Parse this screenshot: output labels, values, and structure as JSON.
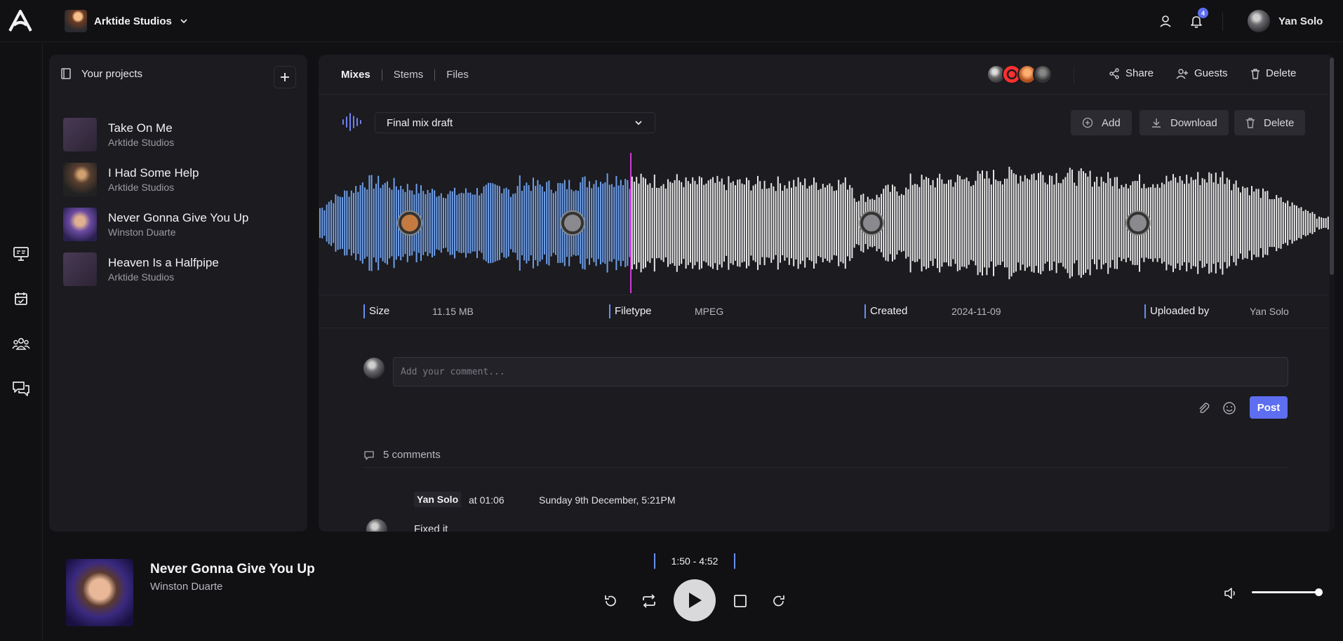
{
  "header": {
    "studio_name": "Arktide Studios",
    "notification_count": "4",
    "user_name": "Yan Solo"
  },
  "projects": {
    "title": "Your projects",
    "items": [
      {
        "title": "Take On Me",
        "owner": "Arktide Studios"
      },
      {
        "title": "I Had Some Help",
        "owner": "Arktide Studios"
      },
      {
        "title": "Never Gonna Give You Up",
        "owner": "Winston Duarte"
      },
      {
        "title": "Heaven Is a Halfpipe",
        "owner": "Arktide Studios"
      }
    ]
  },
  "main": {
    "tabs": [
      {
        "label": "Mixes"
      },
      {
        "label": "Stems"
      },
      {
        "label": "Files"
      }
    ],
    "actions": {
      "share": "Share",
      "guests": "Guests",
      "delete": "Delete"
    },
    "mix_selected": "Final mix draft",
    "tools": {
      "add": "Add",
      "download": "Download",
      "delete": "Delete"
    },
    "waveform": {
      "playhead_fraction": 0.307,
      "played_color": "#6f9ee8",
      "unplayed_color": "#e6e6e6",
      "playhead_color": "#d23ad6"
    },
    "meta": {
      "size_label": "Size",
      "size_value": "11.15 MB",
      "filetype_label": "Filetype",
      "filetype_value": "MPEG",
      "created_label": "Created",
      "created_value": "2024-11-09",
      "uploaded_label": "Uploaded by",
      "uploaded_value": "Yan Solo"
    },
    "comment_placeholder": "Add your comment...",
    "post_label": "Post",
    "comments_count": "5 comments",
    "comment": {
      "author": "Yan Solo",
      "at": "at 01:06",
      "date": "Sunday 9th December, 5:21PM",
      "text": "Fixed it"
    }
  },
  "player": {
    "title": "Never Gonna Give You Up",
    "artist": "Winston Duarte",
    "time": "1:50 - 4:52",
    "volume": 0.95
  },
  "colors": {
    "accent": "#5d6ef0",
    "background": "#111114",
    "panel": "#1b1b20"
  }
}
